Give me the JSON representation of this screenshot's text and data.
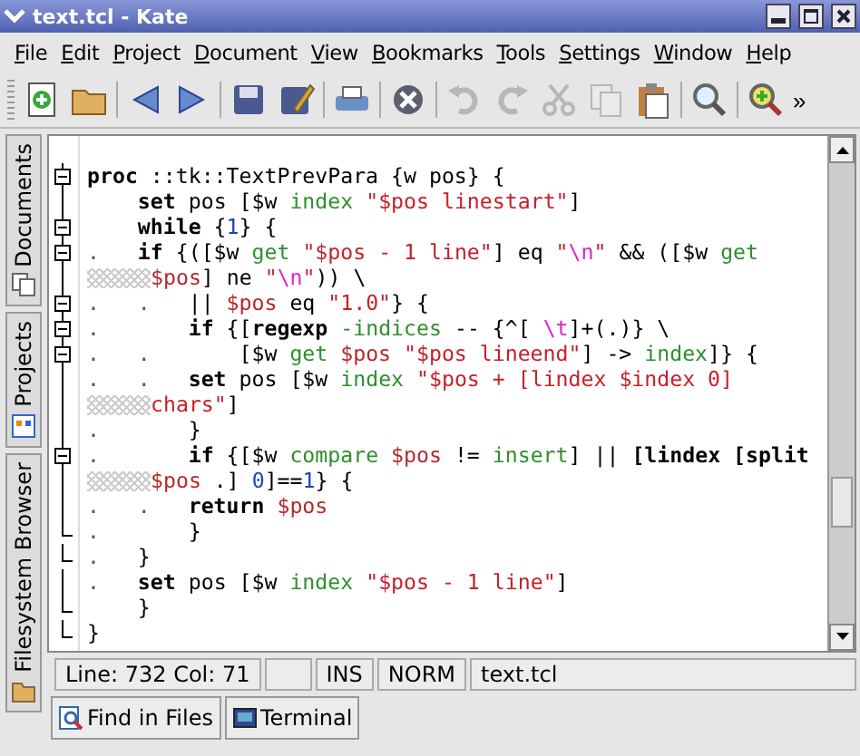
{
  "window": {
    "title": "text.tcl - Kate"
  },
  "menu": [
    "File",
    "Edit",
    "Project",
    "Document",
    "View",
    "Bookmarks",
    "Tools",
    "Settings",
    "Window",
    "Help"
  ],
  "toolbar": {
    "items": [
      {
        "kind": "new",
        "disabled": false
      },
      {
        "kind": "open",
        "disabled": false
      },
      {
        "kind": "sep"
      },
      {
        "kind": "back",
        "disabled": false
      },
      {
        "kind": "forward",
        "disabled": false
      },
      {
        "kind": "sep"
      },
      {
        "kind": "save",
        "disabled": false
      },
      {
        "kind": "saveas",
        "disabled": false
      },
      {
        "kind": "sep"
      },
      {
        "kind": "print",
        "disabled": false
      },
      {
        "kind": "sep"
      },
      {
        "kind": "close",
        "disabled": false
      },
      {
        "kind": "sep"
      },
      {
        "kind": "undo",
        "disabled": true
      },
      {
        "kind": "redo",
        "disabled": true
      },
      {
        "kind": "cut",
        "disabled": true
      },
      {
        "kind": "copy",
        "disabled": true
      },
      {
        "kind": "paste",
        "disabled": false
      },
      {
        "kind": "sep"
      },
      {
        "kind": "find",
        "disabled": false
      },
      {
        "kind": "sep"
      },
      {
        "kind": "zoom",
        "disabled": false
      }
    ],
    "overflow": "»"
  },
  "side_tabs": [
    "Documents",
    "Projects",
    "Filesystem Browser"
  ],
  "editor": {
    "lines": [
      {
        "collapsible": true,
        "block_end": false,
        "wrap": false,
        "tokens": [
          {
            "kind": "kw",
            "text": "proc"
          },
          {
            "kind": "plain",
            "text": " ::tk::TextPrevPara {w pos} {"
          }
        ]
      },
      {
        "collapsible": false,
        "block_end": false,
        "wrap": false,
        "tokens": [
          {
            "kind": "kw",
            "text": "    set"
          },
          {
            "kind": "plain",
            "text": " pos [$w "
          },
          {
            "kind": "cmd",
            "text": "index "
          },
          {
            "kind": "str",
            "text": "\"$pos linestart\""
          },
          {
            "kind": "plain",
            "text": "]"
          }
        ]
      },
      {
        "collapsible": true,
        "block_end": false,
        "wrap": false,
        "tokens": [
          {
            "kind": "kw",
            "text": "    while"
          },
          {
            "kind": "plain",
            "text": " {"
          },
          {
            "kind": "num",
            "text": "1"
          },
          {
            "kind": "plain",
            "text": "} {"
          }
        ]
      },
      {
        "collapsible": true,
        "block_end": false,
        "wrap": false,
        "tokens": [
          {
            "kind": "guide",
            "text": ".   "
          },
          {
            "kind": "kw",
            "text": "if"
          },
          {
            "kind": "plain",
            "text": " {([$w "
          },
          {
            "kind": "cmd",
            "text": "get "
          },
          {
            "kind": "str",
            "text": "\"$pos - 1 line\""
          },
          {
            "kind": "plain",
            "text": "] eq "
          },
          {
            "kind": "str",
            "text": "\""
          },
          {
            "kind": "esc",
            "text": "\\n"
          },
          {
            "kind": "str",
            "text": "\""
          },
          {
            "kind": "plain",
            "text": " && ([$w "
          },
          {
            "kind": "cmd",
            "text": "get"
          }
        ]
      },
      {
        "collapsible": false,
        "block_end": false,
        "wrap": true,
        "tokens": [
          {
            "kind": "var",
            "text": "$pos"
          },
          {
            "kind": "plain",
            "text": "] ne "
          },
          {
            "kind": "str",
            "text": "\""
          },
          {
            "kind": "esc",
            "text": "\\n"
          },
          {
            "kind": "str",
            "text": "\""
          },
          {
            "kind": "plain",
            "text": ")) \\"
          }
        ]
      },
      {
        "collapsible": true,
        "block_end": false,
        "wrap": false,
        "tokens": [
          {
            "kind": "guide",
            "text": ".   .   "
          },
          {
            "kind": "plain",
            "text": "|| "
          },
          {
            "kind": "var",
            "text": "$pos"
          },
          {
            "kind": "plain",
            "text": " eq "
          },
          {
            "kind": "str",
            "text": "\"1.0\""
          },
          {
            "kind": "plain",
            "text": "} {"
          }
        ]
      },
      {
        "collapsible": true,
        "block_end": false,
        "wrap": false,
        "tokens": [
          {
            "kind": "guide",
            "text": ".       "
          },
          {
            "kind": "kw",
            "text": "if"
          },
          {
            "kind": "plain",
            "text": " {["
          },
          {
            "kind": "kw",
            "text": "regexp "
          },
          {
            "kind": "cmd",
            "text": "-indices"
          },
          {
            "kind": "plain",
            "text": " -- {^[ "
          },
          {
            "kind": "esc",
            "text": "\\t"
          },
          {
            "kind": "plain",
            "text": "]+(.)} \\"
          }
        ]
      },
      {
        "collapsible": true,
        "block_end": false,
        "wrap": false,
        "tokens": [
          {
            "kind": "guide",
            "text": ".   .       "
          },
          {
            "kind": "plain",
            "text": "[$w "
          },
          {
            "kind": "cmd",
            "text": "get "
          },
          {
            "kind": "var",
            "text": "$pos"
          },
          {
            "kind": "str",
            "text": " \"$pos lineend\""
          },
          {
            "kind": "plain",
            "text": "] -> "
          },
          {
            "kind": "cmd",
            "text": "index"
          },
          {
            "kind": "plain",
            "text": "]} {"
          }
        ]
      },
      {
        "collapsible": false,
        "block_end": false,
        "wrap": false,
        "tokens": [
          {
            "kind": "guide",
            "text": ".   .   "
          },
          {
            "kind": "kw",
            "text": "set"
          },
          {
            "kind": "plain",
            "text": " pos [$w "
          },
          {
            "kind": "cmd",
            "text": "index "
          },
          {
            "kind": "str",
            "text": "\"$pos + [lindex $index 0]"
          }
        ]
      },
      {
        "collapsible": false,
        "block_end": false,
        "wrap": true,
        "tokens": [
          {
            "kind": "str",
            "text": "chars\""
          },
          {
            "kind": "plain",
            "text": "]"
          }
        ]
      },
      {
        "collapsible": false,
        "block_end": false,
        "wrap": false,
        "tokens": [
          {
            "kind": "guide",
            "text": ".       "
          },
          {
            "kind": "plain",
            "text": "}"
          }
        ]
      },
      {
        "collapsible": true,
        "block_end": false,
        "wrap": false,
        "tokens": [
          {
            "kind": "guide",
            "text": ".       "
          },
          {
            "kind": "kw",
            "text": "if"
          },
          {
            "kind": "plain",
            "text": " {[$w "
          },
          {
            "kind": "cmd",
            "text": "compare "
          },
          {
            "kind": "var",
            "text": "$pos"
          },
          {
            "kind": "plain",
            "text": " != "
          },
          {
            "kind": "cmd",
            "text": "insert"
          },
          {
            "kind": "plain",
            "text": "] || "
          },
          {
            "kind": "kw",
            "text": "[lindex [split"
          }
        ]
      },
      {
        "collapsible": false,
        "block_end": false,
        "wrap": true,
        "tokens": [
          {
            "kind": "var",
            "text": "$pos"
          },
          {
            "kind": "plain",
            "text": " .] "
          },
          {
            "kind": "num",
            "text": "0"
          },
          {
            "kind": "plain",
            "text": "]=="
          },
          {
            "kind": "num",
            "text": "1"
          },
          {
            "kind": "plain",
            "text": "} {"
          }
        ]
      },
      {
        "collapsible": false,
        "block_end": false,
        "wrap": false,
        "tokens": [
          {
            "kind": "guide",
            "text": ".   .   "
          },
          {
            "kind": "kw",
            "text": "return "
          },
          {
            "kind": "var",
            "text": "$pos"
          }
        ]
      },
      {
        "collapsible": false,
        "block_end": true,
        "wrap": false,
        "tokens": [
          {
            "kind": "guide",
            "text": ".       "
          },
          {
            "kind": "plain",
            "text": "}"
          }
        ]
      },
      {
        "collapsible": false,
        "block_end": true,
        "wrap": false,
        "tokens": [
          {
            "kind": "guide",
            "text": ".   "
          },
          {
            "kind": "plain",
            "text": "}"
          }
        ]
      },
      {
        "collapsible": false,
        "block_end": false,
        "wrap": false,
        "tokens": [
          {
            "kind": "guide",
            "text": ".   "
          },
          {
            "kind": "kw",
            "text": "set"
          },
          {
            "kind": "plain",
            "text": " pos [$w "
          },
          {
            "kind": "cmd",
            "text": "index "
          },
          {
            "kind": "str",
            "text": "\"$pos - 1 line\""
          },
          {
            "kind": "plain",
            "text": "]"
          }
        ]
      },
      {
        "collapsible": false,
        "block_end": true,
        "wrap": false,
        "tokens": [
          {
            "kind": "plain",
            "text": "    }"
          }
        ]
      },
      {
        "collapsible": false,
        "block_end": true,
        "wrap": false,
        "tokens": [
          {
            "kind": "plain",
            "text": "}"
          }
        ]
      }
    ]
  },
  "status_bar": {
    "position": "Line: 732 Col: 71",
    "mode": "INS",
    "input": "NORM",
    "file": "text.tcl"
  },
  "bottom_tabs": [
    "Find in Files",
    "Terminal"
  ]
}
